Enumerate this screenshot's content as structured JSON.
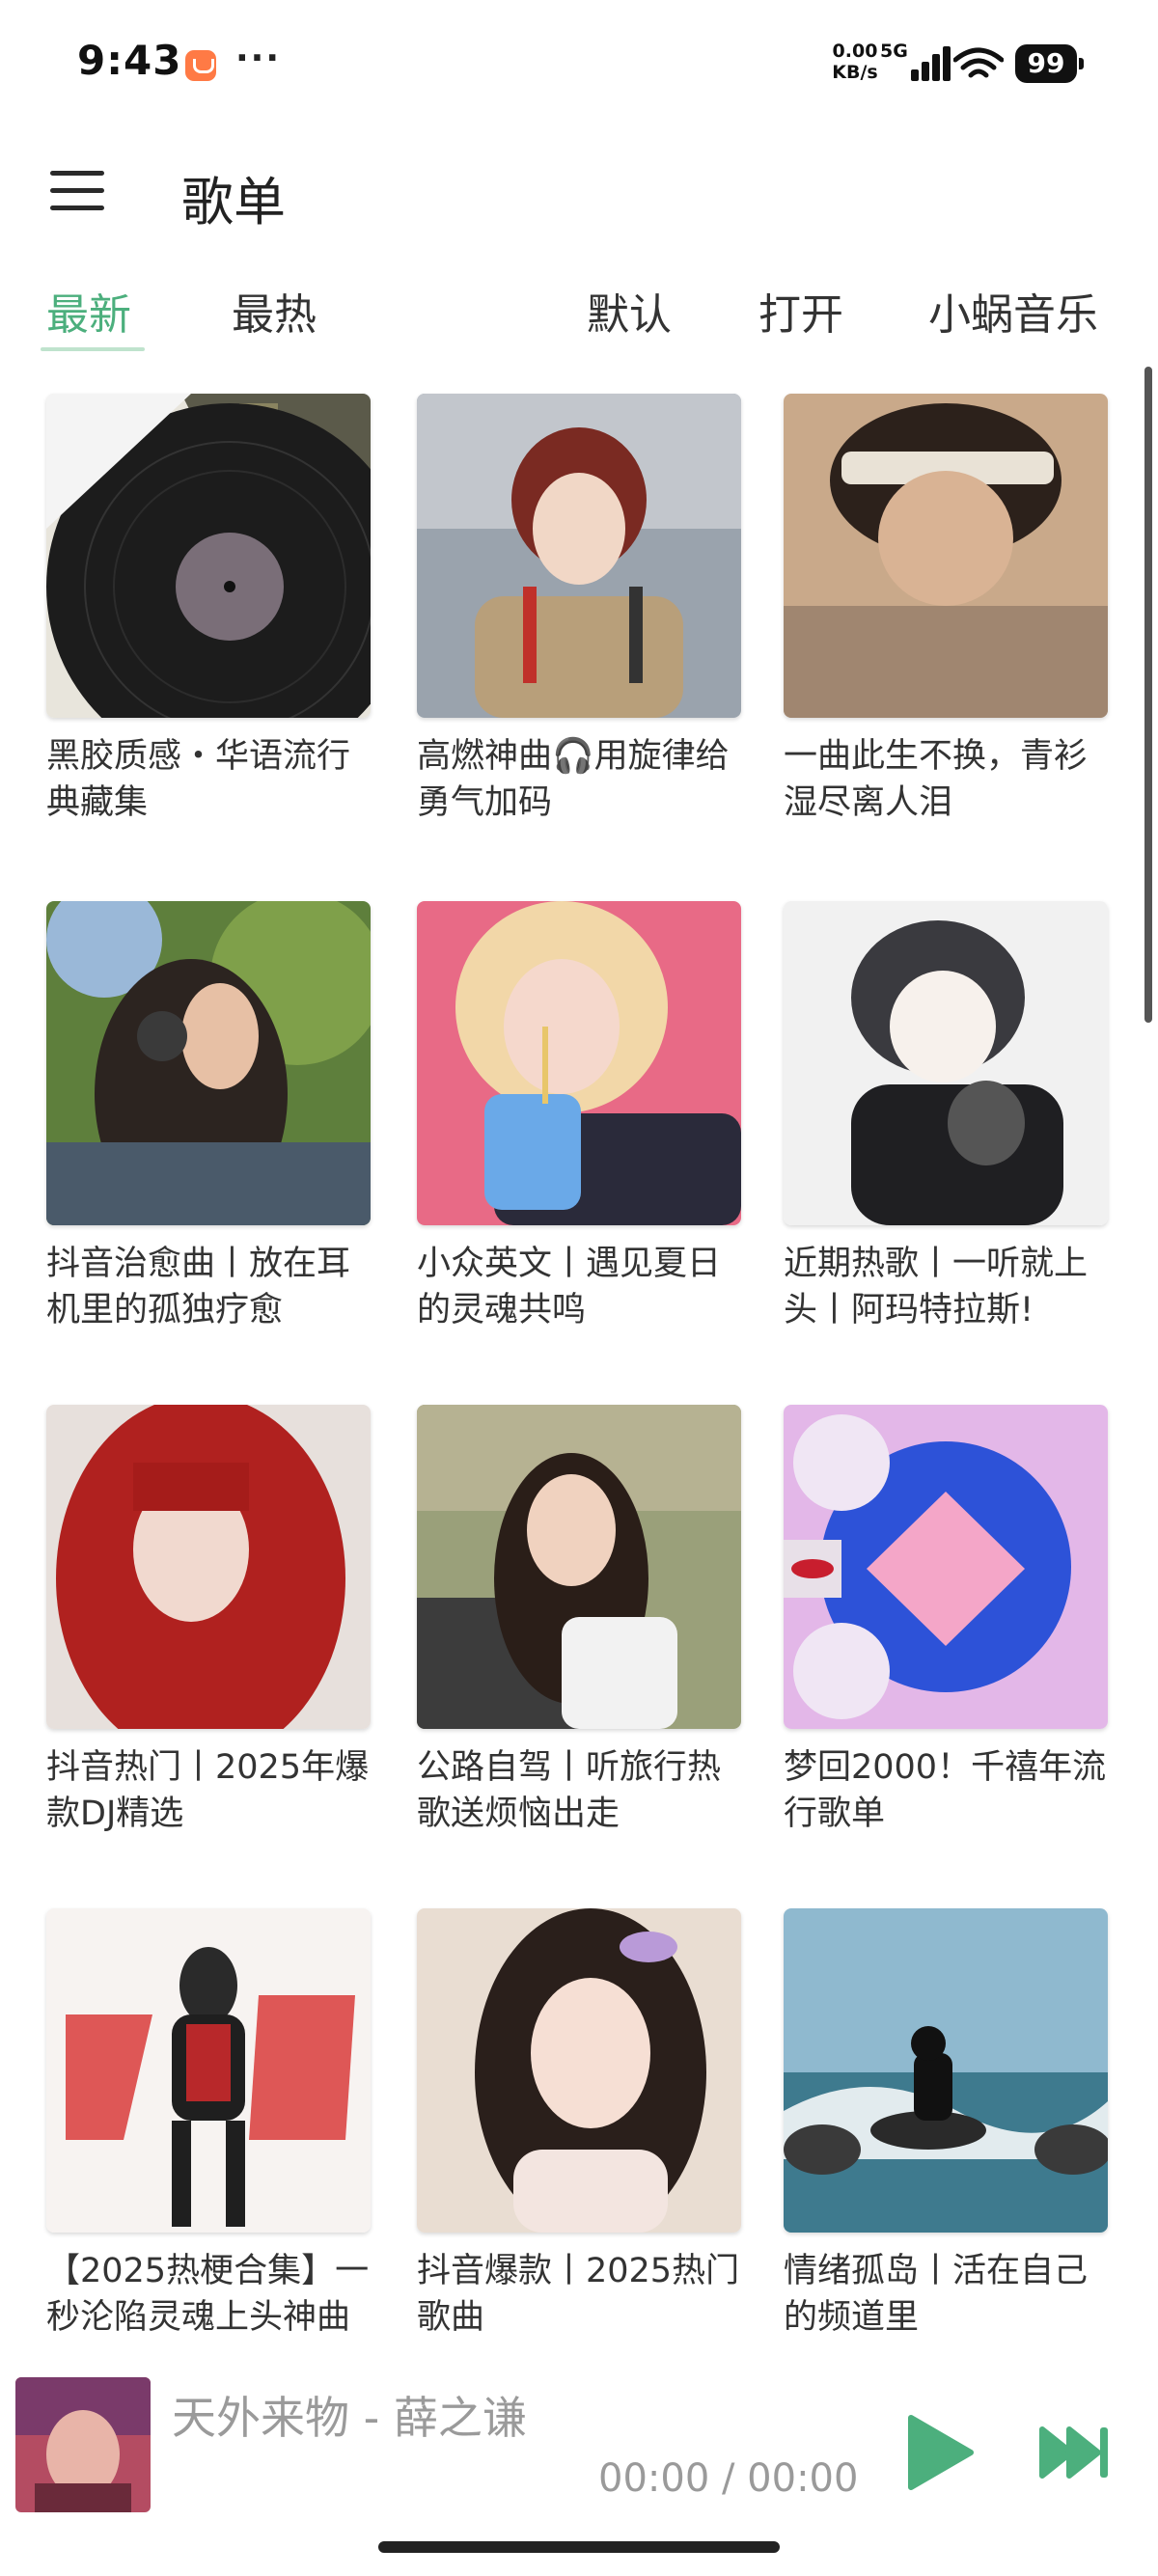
{
  "status_bar": {
    "time": "9:43",
    "dots": "···",
    "speed_value": "0.00",
    "speed_unit": "KB/s",
    "network": "5G",
    "battery": "99"
  },
  "header": {
    "title": "歌单",
    "menu_icon": "hamburger-menu-icon"
  },
  "tabs": [
    {
      "label": "最新",
      "active": true
    },
    {
      "label": "最热",
      "active": false
    },
    {
      "label": "默认",
      "active": false
    },
    {
      "label": "打开",
      "active": false
    },
    {
      "label": "小蜗音乐",
      "active": false
    }
  ],
  "playlists": [
    {
      "title": "黑胶质感・华语流行典藏集"
    },
    {
      "title": "高燃神曲🎧用旋律给勇气加码"
    },
    {
      "title": "一曲此生不换，青衫湿尽离人泪"
    },
    {
      "title": "抖音治愈曲丨放在耳机里的孤独疗愈"
    },
    {
      "title": "小众英文丨遇见夏日的灵魂共鸣"
    },
    {
      "title": "近期热歌丨一听就上头丨阿玛特拉斯!"
    },
    {
      "title": "抖音热门丨2025年爆款DJ精选"
    },
    {
      "title": "公路自驾丨听旅行热歌送烦恼出走"
    },
    {
      "title": "梦回2000！千禧年流行歌单"
    },
    {
      "title": "【2025热梗合集】一秒沦陷灵魂上头神曲"
    },
    {
      "title": "抖音爆款丨2025热门歌曲"
    },
    {
      "title": "情绪孤岛丨活在自己的频道里"
    }
  ],
  "player": {
    "song": "天外来物 - 薛之谦",
    "time": "00:00 / 00:00",
    "play_icon": "play-icon",
    "next_icon": "skip-next-icon"
  },
  "colors": {
    "accent": "#4caf7d",
    "text": "#333333",
    "muted": "#9a9a9a"
  }
}
